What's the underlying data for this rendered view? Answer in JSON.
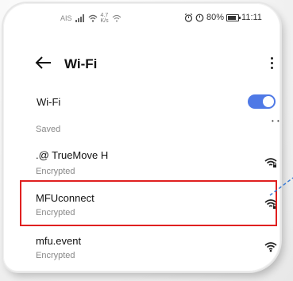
{
  "status_bar": {
    "carrier": "AIS",
    "net_speed_value": "4.7",
    "net_speed_unit": "K/s",
    "battery_percent": "80%",
    "time": "11:11"
  },
  "app_bar": {
    "title": "Wi-Fi",
    "back_icon": "arrow-left-icon",
    "more_icon": "more-vertical-icon"
  },
  "wifi_toggle": {
    "label": "Wi-Fi",
    "state": "on"
  },
  "saved_section": {
    "label": "Saved"
  },
  "networks": [
    {
      "name": ".@ TrueMove H",
      "status": "Encrypted",
      "icon": "wifi-lock-icon"
    },
    {
      "name": "MFUconnect",
      "status": "Encrypted",
      "icon": "wifi-lock-icon"
    },
    {
      "name": "mfu.event",
      "status": "Encrypted",
      "icon": "wifi-icon"
    }
  ],
  "colors": {
    "accent": "#4f79e6",
    "highlight_border": "#e02020",
    "pointer_line": "#3a7bd5"
  }
}
